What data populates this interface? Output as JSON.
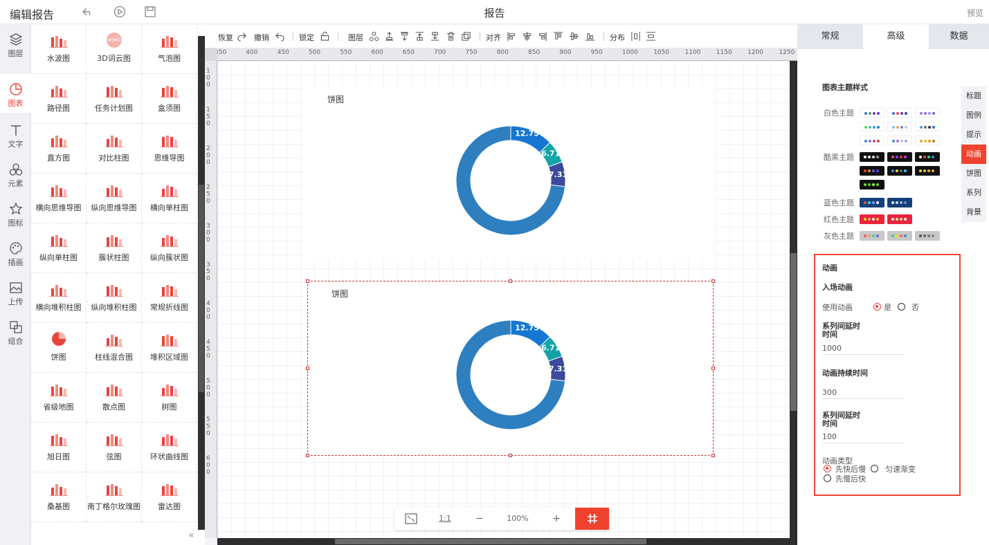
{
  "app": {
    "title": "编辑报告",
    "doc_title": "报告",
    "preview_label": "预览"
  },
  "leftnav": [
    {
      "label": "图层",
      "icon": "layers-icon"
    },
    {
      "label": "图表",
      "icon": "chart-icon",
      "active": true
    },
    {
      "label": "文字",
      "icon": "text-icon"
    },
    {
      "label": "元素",
      "icon": "elements-icon"
    },
    {
      "label": "图标",
      "icon": "star-icon"
    },
    {
      "label": "插画",
      "icon": "palette-icon"
    },
    {
      "label": "上传",
      "icon": "upload-image-icon"
    },
    {
      "label": "组合",
      "icon": "group-icon"
    }
  ],
  "palette": [
    "水波图",
    "3D词云图",
    "气泡图",
    "路径图",
    "任务计划图",
    "盒须图",
    "直方图",
    "对比柱图",
    "思维导图",
    "横向思维导图",
    "纵向思维导图",
    "横向单柱图",
    "纵向单柱图",
    "簇状柱图",
    "纵向簇状图",
    "横向堆积柱图",
    "纵向堆积柱图",
    "常规折线图",
    "饼图",
    "柱线混合图",
    "堆积区域图",
    "省级地图",
    "散点图",
    "树图",
    "旭日图",
    "弦图",
    "环状曲线图",
    "桑基图",
    "南丁格尔玫瑰图",
    "雷达图"
  ],
  "palette_icon_text": "WORD",
  "toolbar": {
    "restore": "恢复",
    "undo": "撤销",
    "lock": "锁定",
    "layer": "图层",
    "align": "对齐",
    "distribute": "分布"
  },
  "ruler_labels": [
    "350",
    "400",
    "450",
    "500",
    "550",
    "600",
    "650",
    "700",
    "750",
    "800",
    "850",
    "900",
    "950",
    "1000",
    "1050",
    "1100",
    "1150",
    "1200",
    "1250"
  ],
  "ruler_v_labels": [
    "100",
    "150",
    "200",
    "250",
    "300",
    "350",
    "400",
    "450",
    "500",
    "550",
    "600"
  ],
  "charts": [
    {
      "title": "饼图"
    },
    {
      "title": "饼图"
    }
  ],
  "chart_data": [
    {
      "type": "pie",
      "title": "饼图",
      "donut": true,
      "labels": [
        "12.75%",
        "6.71%",
        "7.31%",
        "73.23%"
      ],
      "values": [
        12.75,
        6.71,
        7.31,
        73.23
      ],
      "colors": [
        "#1677d2",
        "#13a3a8",
        "#3b4a9a",
        "#2e7fc0"
      ]
    },
    {
      "type": "pie",
      "title": "饼图",
      "donut": true,
      "labels": [
        "12.75%",
        "6.71%",
        "7.31%",
        "73.23%"
      ],
      "values": [
        12.75,
        6.71,
        7.31,
        73.23
      ],
      "colors": [
        "#1677d2",
        "#13a3a8",
        "#3b4a9a",
        "#2e7fc0"
      ]
    }
  ],
  "zoom": {
    "fit": "fit-icon",
    "one_to_one": "1:1",
    "minus": "−",
    "level": "100%",
    "plus": "+"
  },
  "right": {
    "tabs": [
      "常规",
      "高级",
      "数据"
    ],
    "active_tab": "高级",
    "theme_title": "图表主题样式",
    "themes": [
      {
        "label": "白色主题",
        "bg": "#ffffff",
        "rows": [
          [
            [
              "#3c6fd8",
              "#4ab05e",
              "#8c2cc4",
              "#6c34d8"
            ],
            [
              "#3c6fd8",
              "#e04a4a",
              "#5f39c8",
              "#3b4a9a"
            ],
            [
              "#a07ae6",
              "#8c6ad2",
              "#a38ae2",
              "#7a66d0"
            ]
          ],
          [
            [
              "#6cd04c",
              "#3bbde8",
              "#2ea4e0",
              "#1e7ad8"
            ],
            [
              "#7ec2e8",
              "#e8a24c",
              "#6c8ae0",
              "#c9c9c9"
            ],
            [
              "#3aa0d8",
              "#6a6a6a",
              "#333333",
              "#2c6ad0"
            ]
          ],
          [
            [
              "#4b82d4",
              "#7a7ad8",
              "#e23f8a",
              "#d64141"
            ],
            [
              "#4a8ae2",
              "#9b72e0",
              "#c0c0c0",
              "#7fb3ea"
            ],
            [
              "#e8a038",
              "#e8c038",
              "#d09a2c",
              "#b87a24"
            ]
          ]
        ]
      },
      {
        "label": "酷黑主题",
        "bg": "#111111",
        "rows": [
          [
            [
              "#ffffff",
              "#ffffff",
              "#dddddd",
              "#999999"
            ],
            [
              "#e63b9a",
              "#8a3cf0",
              "#e03a3a",
              "#d83ad0"
            ],
            [
              "#ffffff",
              "#e84a4a",
              "#3ad07a",
              "#3a8ae8"
            ]
          ],
          [
            [
              "#e84a2a",
              "#f08a2a",
              "#3a6ae8",
              "#6a3ae8"
            ],
            [
              "#3a8ae8",
              "#e8d83a",
              "#6a6a6a",
              "#3ad0e8"
            ],
            [
              "#e8d83a",
              "#e8c82a",
              "#d8b82a",
              "#e8a82a"
            ]
          ],
          [
            [
              "#7ad83a",
              "#5ac82a",
              "#9ae84a",
              "#6ad83a"
            ]
          ]
        ]
      },
      {
        "label": "蓝色主题",
        "bg": "#13407a",
        "rows": [
          [
            [
              "#e85a3a",
              "#3ad0e8",
              "#8a9ae8",
              "#ffffff"
            ],
            [
              "#ffffff",
              "#c8d8ee",
              "#9ab4dc",
              "#6a90c8"
            ]
          ]
        ]
      },
      {
        "label": "红色主题",
        "bg": "#e8233b",
        "rows": [
          [
            [
              "#f8d84a",
              "#f8a84a",
              "#ffffff",
              "#f8c84a"
            ],
            [
              "#ffffff",
              "#f8e8a8",
              "#f8d88a",
              "#ffffff"
            ]
          ]
        ]
      },
      {
        "label": "灰色主题",
        "bg": "#c8c8c8",
        "rows": [
          [
            [
              "#e85a5a",
              "#e8a84a",
              "#3ad0a8",
              "#6a6ad8"
            ],
            [
              "#3ad07a",
              "#e8d83a",
              "#f86a3a",
              "#3a8ae8"
            ],
            [
              "#555555",
              "#666666",
              "#777777",
              "#888888"
            ]
          ]
        ]
      }
    ],
    "sidetabs": [
      "标题",
      "图例",
      "提示",
      "动画",
      "饼图",
      "系列",
      "背景"
    ],
    "active_sidetab": "动画",
    "anim": {
      "section": "动画",
      "entry": "入场动画",
      "use_label": "使用动画",
      "yes": "是",
      "no": "否",
      "use_value": "是",
      "series_delay_label": "系列间延时时间",
      "series_delay_value": "1000",
      "duration_label": "动画持续时间",
      "duration_value": "300",
      "series_delay2_label": "系列间延时时间",
      "series_delay2_value": "100",
      "type_label": "动画类型",
      "type_options": [
        "先快后慢",
        "匀速渐变",
        "先慢后快"
      ],
      "type_value": "先快后慢"
    }
  }
}
